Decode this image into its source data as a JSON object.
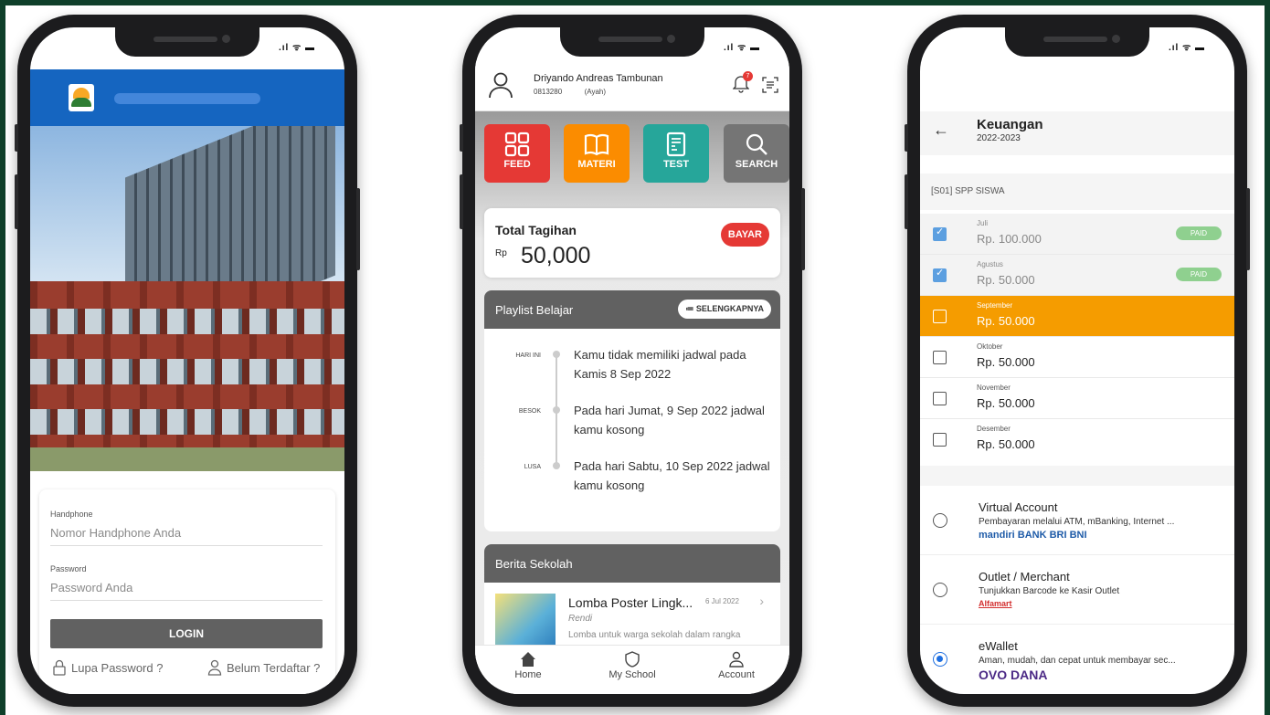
{
  "colors": {
    "frame": "#0f3f2a",
    "blue": "#1565c0",
    "feed": "#e53935",
    "materi": "#fb8c00",
    "test": "#26a69a",
    "search": "#757575",
    "selected": "#f59c00",
    "paid": "#8fd08f"
  },
  "phone1": {
    "status": ".ıl ᯤ ▬",
    "handphone_label": "Handphone",
    "handphone_placeholder": "Nomor Handphone Anda",
    "password_label": "Password",
    "password_placeholder": "Password Anda",
    "login_label": "LOGIN",
    "forgot_label": "Lupa Password ?",
    "register_label": "Belum Terdaftar ?"
  },
  "phone2": {
    "status": ".ıl ᯤ ▬",
    "user_name": "Driyando Andreas Tambunan",
    "user_phone": "0813280",
    "user_role": "(Ayah)",
    "notif_count": "7",
    "tiles": [
      "FEED",
      "MATERI",
      "TEST",
      "SEARCH"
    ],
    "bill_title": "Total Tagihan",
    "bill_currency": "Rp",
    "bill_amount": "50,000",
    "pay_label": "BAYAR",
    "playlist_title": "Playlist Belajar",
    "more_label": "≔ SELENGKAPNYA",
    "playlist": [
      {
        "when": "HARI INI",
        "text": "Kamu tidak memiliki jadwal pada Kamis 8 Sep 2022"
      },
      {
        "when": "BESOK",
        "text": "Pada hari Jumat, 9 Sep 2022 jadwal kamu kosong"
      },
      {
        "when": "LUSA",
        "text": "Pada hari Sabtu, 10 Sep 2022 jadwal kamu kosong"
      }
    ],
    "news_title": "Berita Sekolah",
    "news_item": {
      "title": "Lomba Poster Lingk...",
      "date": "6 Jul 2022",
      "author": "Rendi",
      "desc": "Lomba untuk warga sekolah dalam rangka menyayangi Lingkungan..."
    },
    "nav": [
      "Home",
      "My School",
      "Account"
    ]
  },
  "phone3": {
    "status": ".ıl ᯤ ▬",
    "title": "Keuangan",
    "year": "2022-2023",
    "group": "[S01] SPP SISWA",
    "paid_label": "PAID",
    "rows": [
      {
        "month": "Juli",
        "value": "Rp. 100.000"
      },
      {
        "month": "Agustus",
        "value": "Rp. 50.000"
      },
      {
        "month": "September",
        "value": "Rp. 50.000"
      },
      {
        "month": "Oktober",
        "value": "Rp. 50.000"
      },
      {
        "month": "November",
        "value": "Rp. 50.000"
      },
      {
        "month": "Desember",
        "value": "Rp. 50.000"
      }
    ],
    "methods": [
      {
        "name": "Virtual Account",
        "desc": "Pembayaran melalui ATM, mBanking, Internet ...",
        "logos": "mandiri  BANK BRI  BNI"
      },
      {
        "name": "Outlet / Merchant",
        "desc": "Tunjukkan Barcode ke Kasir Outlet",
        "logos": "Alfamart"
      },
      {
        "name": "eWallet",
        "desc": "Aman, mudah, dan cepat untuk membayar sec...",
        "logos": "OVO DANA"
      }
    ]
  }
}
